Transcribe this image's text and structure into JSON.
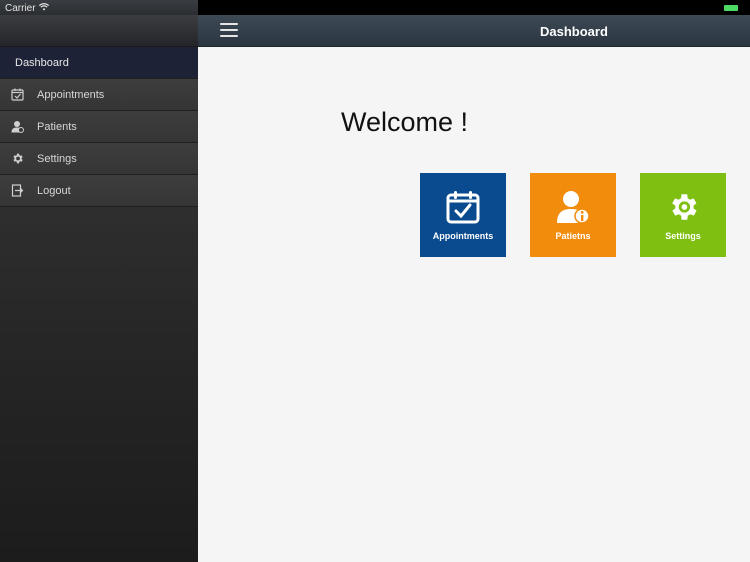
{
  "status_bar": {
    "carrier": "Carrier"
  },
  "sidebar": {
    "items": [
      {
        "label": "Dashboard",
        "icon": "dashboard",
        "active": true
      },
      {
        "label": "Appointments",
        "icon": "calendar-icon"
      },
      {
        "label": "Patients",
        "icon": "user-icon"
      },
      {
        "label": "Settings",
        "icon": "gear-icon"
      },
      {
        "label": "Logout",
        "icon": "logout-icon"
      }
    ]
  },
  "topbar": {
    "title": "Dashboard"
  },
  "main": {
    "welcome": "Welcome !",
    "tiles": [
      {
        "label": "Appointments",
        "color": "#0a4a8e",
        "icon": "calendar-check-icon"
      },
      {
        "label": "Patietns",
        "color": "#f28c0c",
        "icon": "user-info-icon"
      },
      {
        "label": "Settings",
        "color": "#7fbf12",
        "icon": "gear-icon"
      }
    ]
  },
  "colors": {
    "sidebar_active": "#1d2236",
    "topbar": "#2a3540",
    "battery": "#4cd964"
  }
}
